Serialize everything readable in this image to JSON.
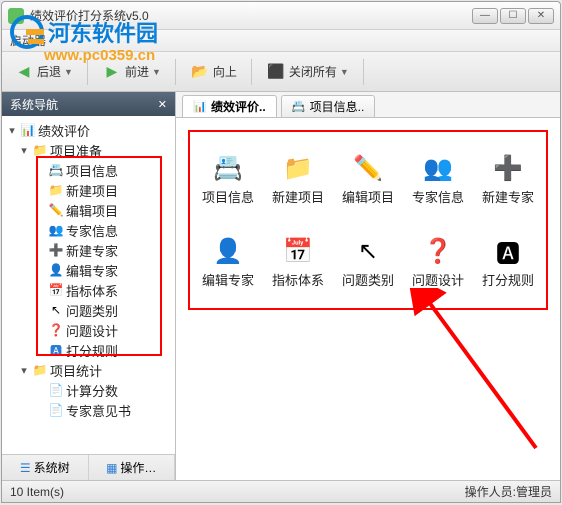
{
  "window": {
    "title": "绩效评价打分系统v5.0"
  },
  "menubar": {
    "start": "启动器"
  },
  "toolbar": {
    "back": "后退",
    "forward": "前进",
    "up": "向上",
    "close_all": "关闭所有"
  },
  "sidebar": {
    "title": "系统导航",
    "tree": {
      "root": "绩效评价",
      "prep": "项目准备",
      "prep_items": [
        "项目信息",
        "新建项目",
        "编辑项目",
        "专家信息",
        "新建专家",
        "编辑专家",
        "指标体系",
        "问题类别",
        "问题设计",
        "打分规则"
      ],
      "stats": "项目统计",
      "stats_items": [
        "计算分数",
        "专家意见书"
      ]
    },
    "tabs": {
      "tree": "系统树",
      "ops": "操作…"
    }
  },
  "main_tabs": {
    "perf": "绩效评价..",
    "proj": "项目信息.."
  },
  "grid": {
    "items": [
      {
        "label": "项目信息",
        "icon": "📇"
      },
      {
        "label": "新建项目",
        "icon": "📁"
      },
      {
        "label": "编辑项目",
        "icon": "✏️"
      },
      {
        "label": "专家信息",
        "icon": "👥"
      },
      {
        "label": "新建专家",
        "icon": "➕"
      },
      {
        "label": "编辑专家",
        "icon": "👤"
      },
      {
        "label": "指标体系",
        "icon": "📅"
      },
      {
        "label": "问题类别",
        "icon": "↖"
      },
      {
        "label": "问题设计",
        "icon": "❓"
      },
      {
        "label": "打分规则",
        "icon": "🅰"
      }
    ]
  },
  "statusbar": {
    "count": "10 Item(s)",
    "operator": "操作人员:管理员"
  },
  "watermark": {
    "text": "河东软件园",
    "url": "www.pc0359.cn"
  }
}
